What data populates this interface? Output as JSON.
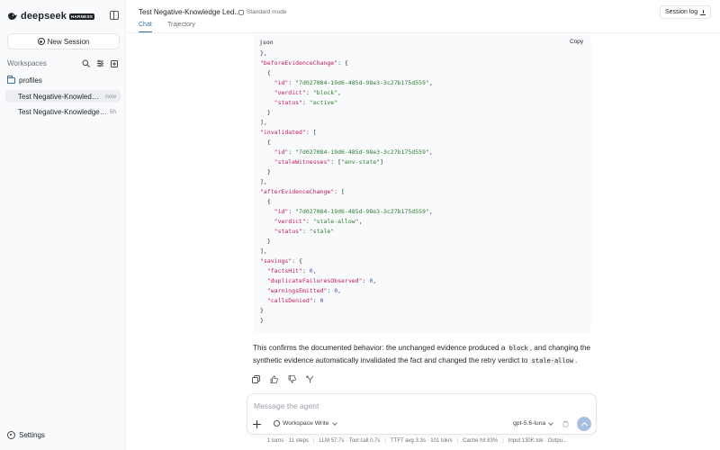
{
  "app": {
    "brand": "deepseek",
    "badge": "HARNESS"
  },
  "sidebar": {
    "new_session_label": "New Session",
    "workspaces_label": "Workspaces",
    "folder_label": "profiles",
    "sessions": [
      {
        "label": "Test Negative-Knowledge L...",
        "time": "now",
        "active": true
      },
      {
        "label": "Test Negative-Knowledge Led...",
        "time": "5h",
        "active": false
      }
    ],
    "settings_label": "Settings"
  },
  "header": {
    "title": "Test Negative-Knowledge Led...",
    "mode": "Standard mode",
    "tabs": [
      "Chat",
      "Trajectory"
    ],
    "session_log_label": "Session log"
  },
  "code_block": {
    "lang": "json",
    "copy_label": "Copy",
    "lines": [
      [
        [
          "p",
          "},"
        ]
      ],
      [
        [
          "k",
          "\"beforeEvidenceChange\""
        ],
        [
          "p",
          ": {"
        ]
      ],
      [
        [
          "p",
          "  {"
        ]
      ],
      [
        [
          "k",
          "    \"id\""
        ],
        [
          "p",
          ": "
        ],
        [
          "s",
          "\"7d027084-19d6-485d-98e3-3c27b175d559\""
        ],
        [
          "p",
          ","
        ]
      ],
      [
        [
          "k",
          "    \"verdict\""
        ],
        [
          "p",
          ": "
        ],
        [
          "s",
          "\"block\""
        ],
        [
          "p",
          ","
        ]
      ],
      [
        [
          "k",
          "    \"status\""
        ],
        [
          "p",
          ": "
        ],
        [
          "s",
          "\"active\""
        ]
      ],
      [
        [
          "p",
          "  }"
        ]
      ],
      [
        [
          "p",
          "],"
        ]
      ],
      [
        [
          "k",
          "\"invalidated\""
        ],
        [
          "p",
          ": ["
        ]
      ],
      [
        [
          "p",
          "  {"
        ]
      ],
      [
        [
          "k",
          "    \"id\""
        ],
        [
          "p",
          ": "
        ],
        [
          "s",
          "\"7d027084-19d6-485d-98e3-3c27b175d559\""
        ],
        [
          "p",
          ","
        ]
      ],
      [
        [
          "k",
          "    \"staleWitnesses\""
        ],
        [
          "p",
          ": ["
        ],
        [
          "s",
          "\"env-state\""
        ],
        [
          "p",
          "]"
        ]
      ],
      [
        [
          "p",
          "  }"
        ]
      ],
      [
        [
          "p",
          "],"
        ]
      ],
      [
        [
          "k",
          "\"afterEvidenceChange\""
        ],
        [
          "p",
          ": ["
        ]
      ],
      [
        [
          "p",
          "  {"
        ]
      ],
      [
        [
          "k",
          "    \"id\""
        ],
        [
          "p",
          ": "
        ],
        [
          "s",
          "\"7d027084-19d6-485d-98e3-3c27b175d559\""
        ],
        [
          "p",
          ","
        ]
      ],
      [
        [
          "k",
          "    \"verdict\""
        ],
        [
          "p",
          ": "
        ],
        [
          "s",
          "\"stale-allow\""
        ],
        [
          "p",
          ","
        ]
      ],
      [
        [
          "k",
          "    \"status\""
        ],
        [
          "p",
          ": "
        ],
        [
          "s",
          "\"stale\""
        ]
      ],
      [
        [
          "p",
          "  }"
        ]
      ],
      [
        [
          "p",
          "],"
        ]
      ],
      [
        [
          "k",
          "\"savings\""
        ],
        [
          "p",
          ": {"
        ]
      ],
      [
        [
          "k",
          "  \"factsHit\""
        ],
        [
          "p",
          ": "
        ],
        [
          "n",
          "0"
        ],
        [
          "p",
          ","
        ]
      ],
      [
        [
          "k",
          "  \"duplicateFailuresObserved\""
        ],
        [
          "p",
          ": "
        ],
        [
          "n",
          "0"
        ],
        [
          "p",
          ","
        ]
      ],
      [
        [
          "k",
          "  \"warningsEmitted\""
        ],
        [
          "p",
          ": "
        ],
        [
          "n",
          "0"
        ],
        [
          "p",
          ","
        ]
      ],
      [
        [
          "k",
          "  \"callsDenied\""
        ],
        [
          "p",
          ": "
        ],
        [
          "n",
          "0"
        ]
      ],
      [
        [
          "p",
          "}"
        ]
      ],
      [
        [
          "p",
          "}"
        ]
      ]
    ]
  },
  "reply": {
    "text_1": "This confirms the documented behavior: the unchanged evidence produced a ",
    "code_1": "block",
    "text_2": ", and changing the synthetic evidence automatically invalidated the fact and changed the retry verdict to ",
    "code_2": "stale-allow",
    "text_3": "."
  },
  "composer": {
    "placeholder": "Message the agent",
    "value": "",
    "permission_label": "Workspace Write",
    "model_label": "gpt-5.6-luna"
  },
  "status_bar": [
    "1 turns · 11 steps",
    "LLM 57.7s · Tool call 0.7s",
    "TTFT avg 3.3s · 101 tok/s",
    "Cache hit 83%",
    "Input 130K tok · Outpu..."
  ],
  "icons": {
    "brand": "whale-logo-icon",
    "sidebar_toggle": "sidebar-toggle-icon",
    "search": "search-icon",
    "filter": "filter-icon",
    "new_folder": "new-folder-icon"
  }
}
